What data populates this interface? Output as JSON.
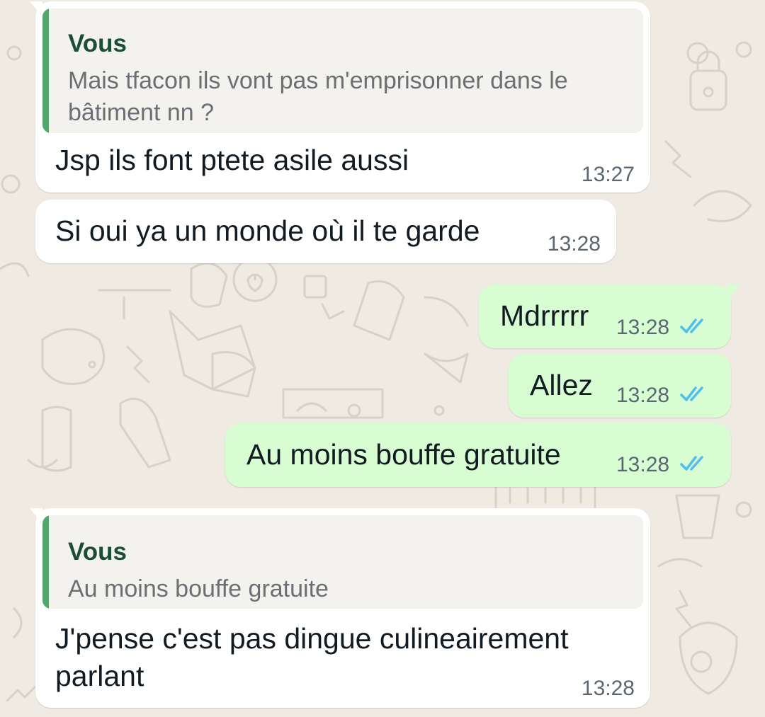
{
  "colors": {
    "incoming_bubble": "#ffffff",
    "outgoing_bubble": "#d9fdd3",
    "quote_bar": "#53a56e",
    "quote_author": "#1d4d35",
    "read_ticks": "#53bdeb",
    "wallpaper": "#efeae2"
  },
  "messages": [
    {
      "direction": "incoming",
      "reply_to": {
        "author": "Vous",
        "text": "Mais tfacon ils vont pas m'emprisonner dans le bâtiment nn ?"
      },
      "text": "Jsp ils font ptete asile aussi",
      "time": "13:27"
    },
    {
      "direction": "incoming",
      "text": "Si oui ya un monde où il te garde",
      "time": "13:28"
    },
    {
      "direction": "outgoing",
      "text": "Mdrrrrr",
      "time": "13:28",
      "status_icon": "double-check-read-icon"
    },
    {
      "direction": "outgoing",
      "text": "Allez",
      "time": "13:28",
      "status_icon": "double-check-read-icon"
    },
    {
      "direction": "outgoing",
      "text": "Au moins bouffe gratuite",
      "time": "13:28",
      "status_icon": "double-check-read-icon"
    },
    {
      "direction": "incoming",
      "reply_to": {
        "author": "Vous",
        "text": "Au moins bouffe gratuite"
      },
      "text": "J'pense c'est pas dingue culineairement parlant",
      "time": "13:28"
    }
  ]
}
